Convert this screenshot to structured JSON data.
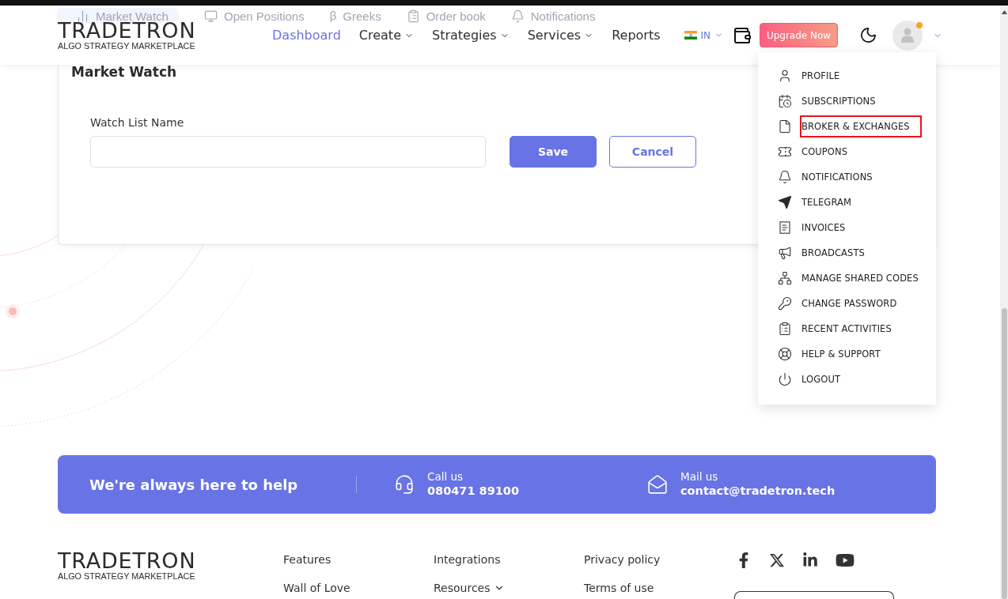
{
  "subnav_tabs": [
    {
      "label": "Market Watch",
      "selected": true
    },
    {
      "label": "Open Positions",
      "selected": false
    },
    {
      "label": "Greeks",
      "glyph": "β",
      "selected": false
    },
    {
      "label": "Order book",
      "selected": false
    },
    {
      "label": "Notifications",
      "selected": false
    }
  ],
  "header": {
    "logo": {
      "name": "TRADETRON",
      "tagline": "ALGO STRATEGY MARKETPLACE"
    },
    "nav": [
      {
        "label": "Dashboard",
        "selected": true,
        "dropdown": false
      },
      {
        "label": "Create",
        "selected": false,
        "dropdown": true
      },
      {
        "label": "Strategies",
        "selected": false,
        "dropdown": true
      },
      {
        "label": "Services",
        "selected": false,
        "dropdown": true
      },
      {
        "label": "Reports",
        "selected": false,
        "dropdown": false
      }
    ],
    "country": "IN",
    "upgrade_button": "Upgrade Now",
    "user_alert": true
  },
  "user_menu": {
    "items": [
      {
        "label": "PROFILE",
        "highlighted": false
      },
      {
        "label": "SUBSCRIPTIONS",
        "highlighted": false
      },
      {
        "label": "BROKER & EXCHANGES",
        "highlighted": true
      },
      {
        "label": "COUPONS",
        "highlighted": false
      },
      {
        "label": "NOTIFICATIONS",
        "highlighted": false
      },
      {
        "label": "TELEGRAM",
        "highlighted": false
      },
      {
        "label": "INVOICES",
        "highlighted": false
      },
      {
        "label": "BROADCASTS",
        "highlighted": false
      },
      {
        "label": "MANAGE SHARED CODES",
        "highlighted": false
      },
      {
        "label": "CHANGE PASSWORD",
        "highlighted": false
      },
      {
        "label": "RECENT ACTIVITIES",
        "highlighted": false
      },
      {
        "label": "HELP & SUPPORT",
        "highlighted": false
      },
      {
        "label": "LOGOUT",
        "highlighted": false
      }
    ]
  },
  "market_watch": {
    "title": "Market Watch",
    "field_label": "Watch List Name",
    "buttons": [
      {
        "label": "Save",
        "kind": "primary"
      },
      {
        "label": "Cancel",
        "kind": "secondary"
      }
    ]
  },
  "help_banner": {
    "heading": "We're always here to help",
    "contacts": [
      {
        "label": "Call us",
        "value": "080471 89100"
      },
      {
        "label": "Mail us",
        "value": "contact@tradetron.tech"
      }
    ]
  },
  "footer": {
    "logo": {
      "name": "TRADETRON",
      "tagline": "ALGO STRATEGY MARKETPLACE"
    },
    "link_columns": [
      {
        "links": [
          {
            "label": "Features",
            "dropdown": false
          },
          {
            "label": "Wall of Love",
            "dropdown": false
          }
        ]
      },
      {
        "links": [
          {
            "label": "Integrations",
            "dropdown": false
          },
          {
            "label": "Resources",
            "dropdown": true
          }
        ]
      },
      {
        "links": [
          {
            "label": "Privacy policy",
            "dropdown": false
          },
          {
            "label": "Terms of use",
            "dropdown": false
          }
        ]
      }
    ]
  }
}
